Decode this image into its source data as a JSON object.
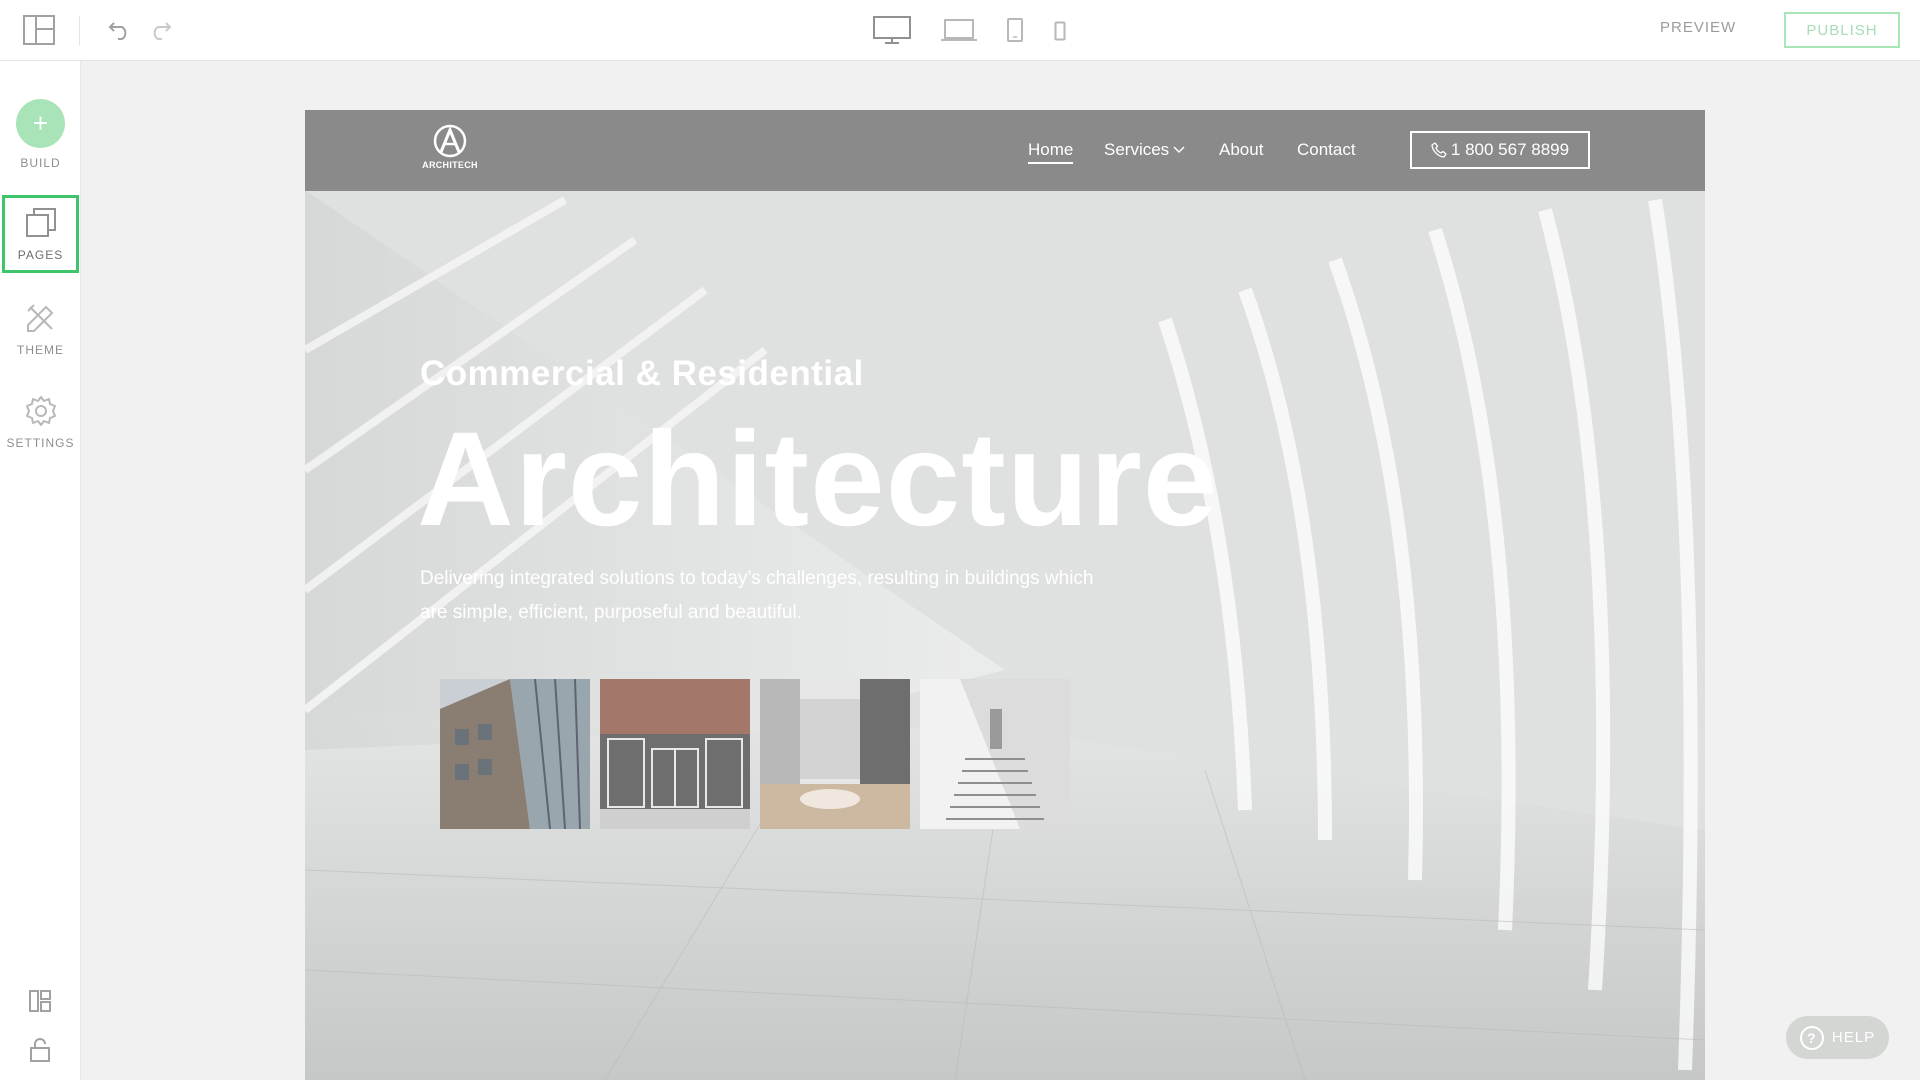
{
  "toolbar": {
    "layout_icon": "layout-icon",
    "undo_icon": "undo-icon",
    "redo_icon": "redo-icon",
    "devices": [
      "desktop-icon",
      "laptop-icon",
      "tablet-icon",
      "mobile-icon"
    ],
    "preview_label": "PREVIEW",
    "publish_label": "PUBLISH"
  },
  "sidebar": {
    "items": [
      {
        "label": "BUILD",
        "icon": "plus-icon"
      },
      {
        "label": "PAGES",
        "icon": "pages-icon",
        "active": true
      },
      {
        "label": "THEME",
        "icon": "theme-icon"
      },
      {
        "label": "SETTINGS",
        "icon": "gear-icon"
      }
    ],
    "bottom_icons": [
      "sections-icon",
      "lock-icon"
    ]
  },
  "site": {
    "logo_text": "ARCHITECH",
    "nav": {
      "home": "Home",
      "services": "Services",
      "about": "About",
      "contact": "Contact"
    },
    "phone": "1 800 567 8899",
    "hero": {
      "subtitle": "Commercial & Residential",
      "title": "Architecture",
      "description": "Delivering integrated solutions to today’s challenges, resulting in buildings which are simple, efficient, purposeful and beautiful."
    }
  },
  "help_label": "HELP",
  "colors": {
    "accent_green": "#3ec46a",
    "build_green": "#a9e4b8",
    "site_nav_bg": "#8a8a8a"
  }
}
